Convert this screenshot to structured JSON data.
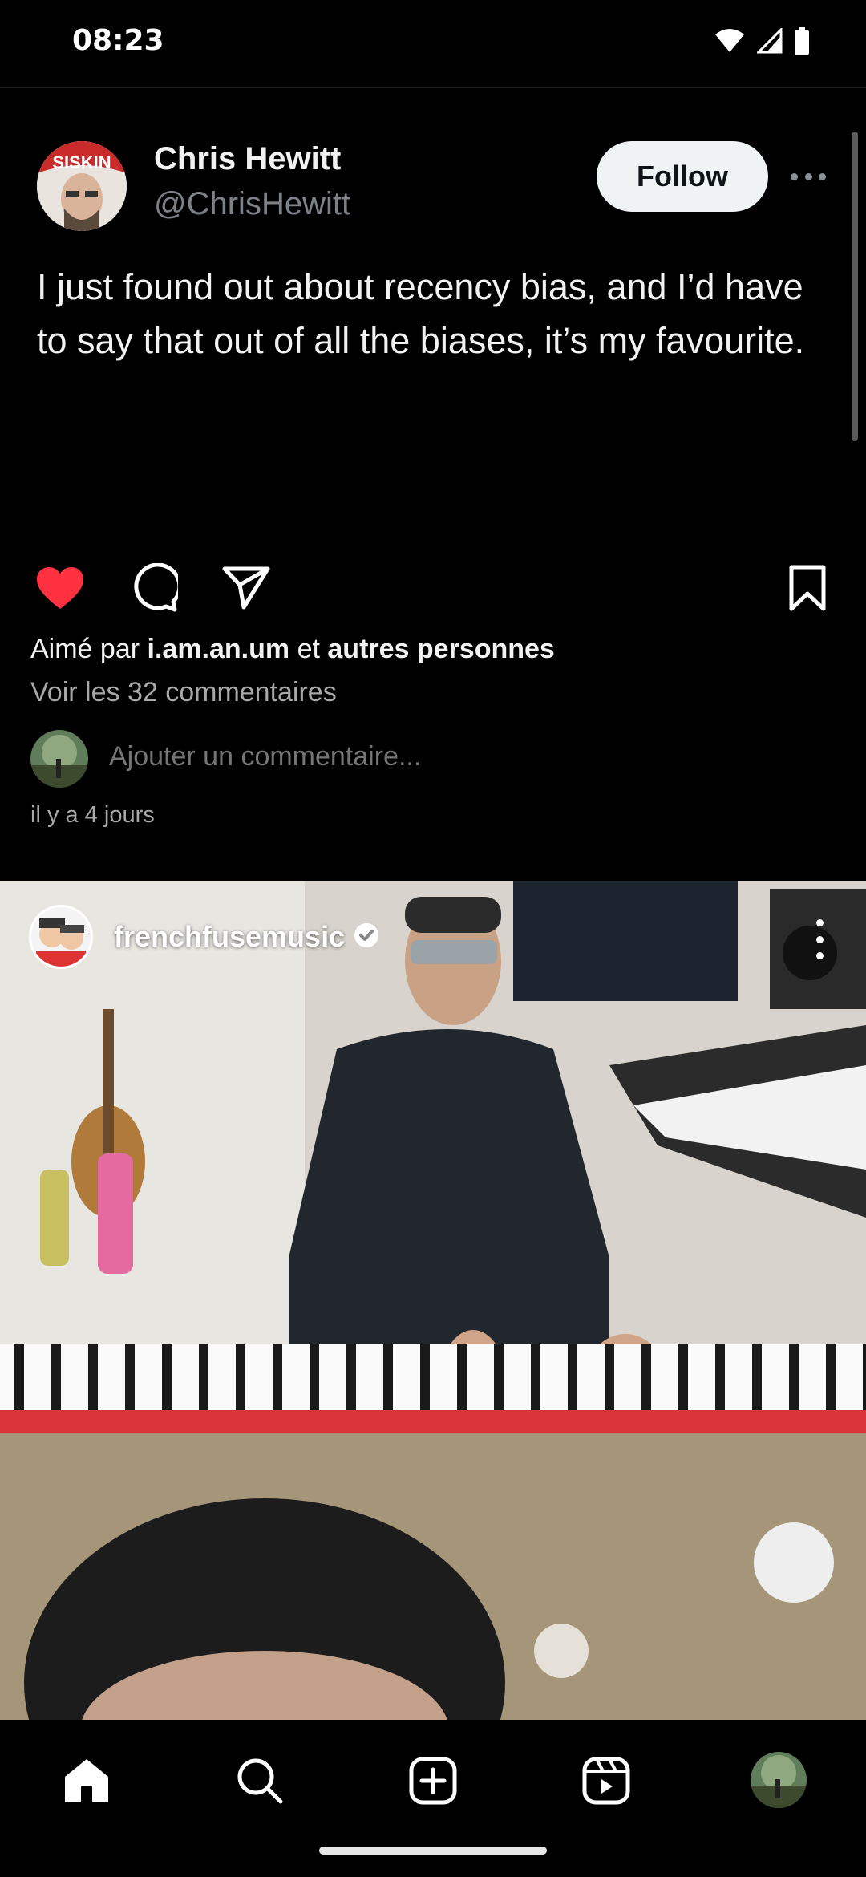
{
  "status_bar": {
    "time": "08:23",
    "icons": [
      "wifi-icon",
      "cell-signal-icon",
      "battery-icon"
    ]
  },
  "tweet": {
    "author_name": "Chris Hewitt",
    "author_handle": "@ChrisHewitt",
    "follow_label": "Follow",
    "text": "I just found out about recency bias, and I’d have to say that out of all the biases, it’s my favourite."
  },
  "post": {
    "liked_prefix": "Aimé par",
    "liked_user": "i.am.an.um",
    "liked_conj": "et",
    "liked_others": "autres personnes",
    "view_comments": "Voir les 32 commentaires",
    "comment_placeholder": "Ajouter un commentaire...",
    "time_ago": "il y a 4 jours",
    "liked": true
  },
  "reel": {
    "username": "frenchfusemusic",
    "verified": true
  },
  "bottom_nav": {
    "items": [
      "home-icon",
      "search-icon",
      "create-icon",
      "reels-icon",
      "profile-avatar"
    ]
  },
  "colors": {
    "background": "#000000",
    "like_red": "#ff3040",
    "follow_bg": "#eff3f4",
    "muted_text": "#a8a8a8"
  }
}
